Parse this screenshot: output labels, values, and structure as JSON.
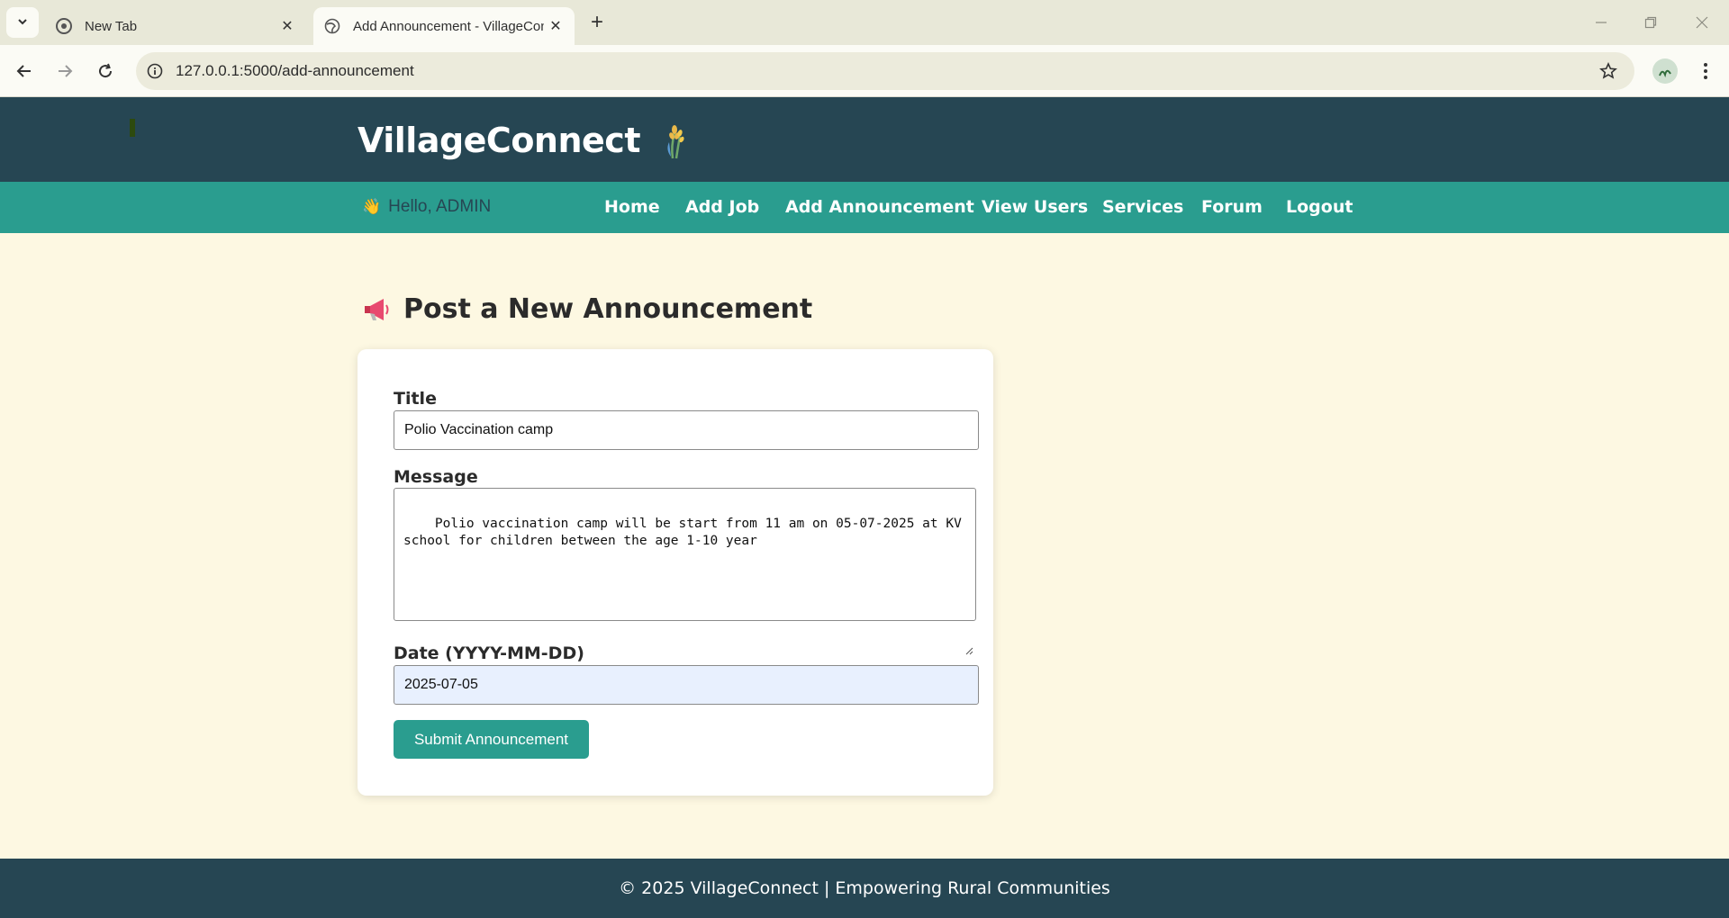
{
  "browser": {
    "tabs": [
      {
        "title": "New Tab",
        "favicon": "chrome-icon"
      },
      {
        "title": "Add Announcement - VillageConnect",
        "favicon": "globe-icon"
      }
    ],
    "url": "127.0.0.1:5000/add-announcement"
  },
  "header": {
    "brand": "VillageConnect",
    "logo_icon": "wheat-icon"
  },
  "nav": {
    "greeting": "Hello, ADMIN",
    "greeting_icon": "👋",
    "links": [
      "Home",
      "Add Job",
      "Add Announcement",
      "View Users",
      "Services",
      "Forum",
      "Logout"
    ]
  },
  "page": {
    "title": "Post a New Announcement",
    "title_icon": "megaphone-icon"
  },
  "form": {
    "title_label": "Title",
    "title_value": "Polio Vaccination camp",
    "message_label": "Message",
    "message_value": "Polio vaccination camp will be start from 11 am on 05-07-2025 at KV\nschool for children between the age 1-10 year",
    "date_label": "Date (YYYY-MM-DD)",
    "date_value": "2025-07-05",
    "submit_label": "Submit Announcement"
  },
  "footer": {
    "text": "© 2025 VillageConnect | Empowering Rural Communities"
  },
  "colors": {
    "header_bg": "#264653",
    "nav_bg": "#2a9d8f",
    "page_bg": "#fdf8e2",
    "button_bg": "#2a9d8f"
  }
}
